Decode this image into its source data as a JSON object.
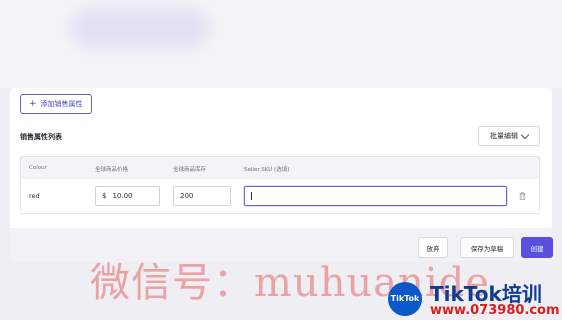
{
  "toolbar": {
    "add_attribute_label": "添加销售属性"
  },
  "section": {
    "title": "销售属性列表"
  },
  "bulk_edit": {
    "label": "批量编辑"
  },
  "table": {
    "headers": [
      "Colour",
      "全球商品价格",
      "全球商品库存",
      "Seller SKU (选填)"
    ],
    "rows": [
      {
        "colour": "red",
        "currency": "$",
        "price": "10.00",
        "stock": "200",
        "sku": ""
      }
    ]
  },
  "footer": {
    "discard_label": "放弃",
    "save_draft_label": "保存为草稿",
    "create_label": "创建"
  },
  "watermark": {
    "text": "微信号：muhuanide"
  },
  "brand": {
    "logo_text": "TikTok",
    "name": "TikTok培训",
    "url": "www.073980.com"
  },
  "colors": {
    "accent": "#5b4fe0",
    "watermark": "#e86464",
    "brand_blue": "#0e3d8f",
    "brand_red": "#d91e1e"
  },
  "icons": [
    "plus-icon",
    "chevron-down-icon",
    "trash-icon"
  ]
}
